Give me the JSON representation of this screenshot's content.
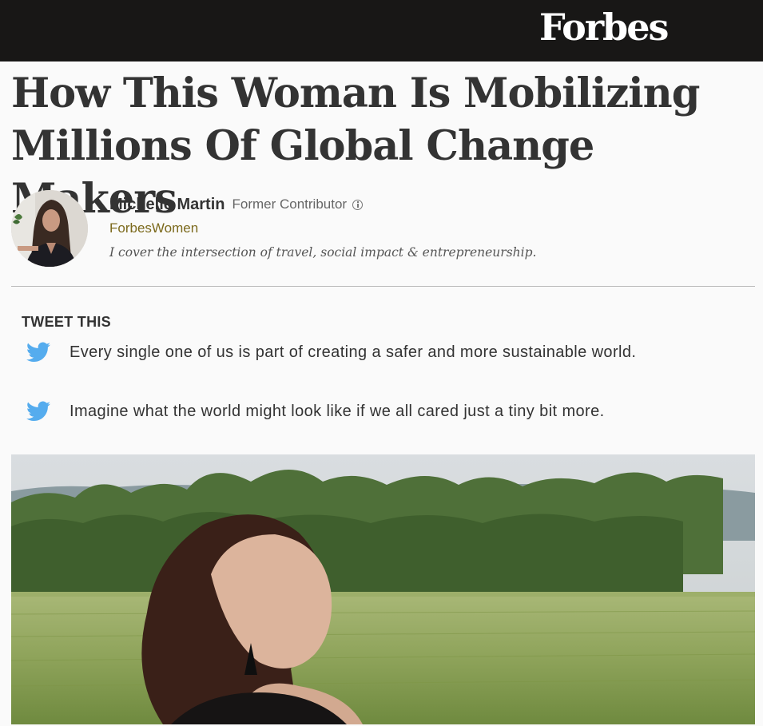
{
  "brand": {
    "logo_text": "Forbes",
    "topbar_color": "#181716"
  },
  "article": {
    "title": "How This Woman Is Mobilizing Millions Of Global Change Makers"
  },
  "author": {
    "name": "Michelle Martin",
    "role": "Former Contributor",
    "info_icon": "info-circle-icon",
    "channel": "ForbesWomen",
    "channel_color": "#7c6a1d",
    "bio": "I cover the intersection of travel, social impact & entrepreneurship."
  },
  "tweet_this": {
    "heading": "TWEET THIS",
    "icon": "twitter-bird-icon",
    "icon_color": "#55acee",
    "items": [
      {
        "text": "Every single one of us is part of creating a safer and more sustainable world."
      },
      {
        "text": "Imagine what the world might look like if we all cared just a tiny bit more."
      }
    ]
  }
}
